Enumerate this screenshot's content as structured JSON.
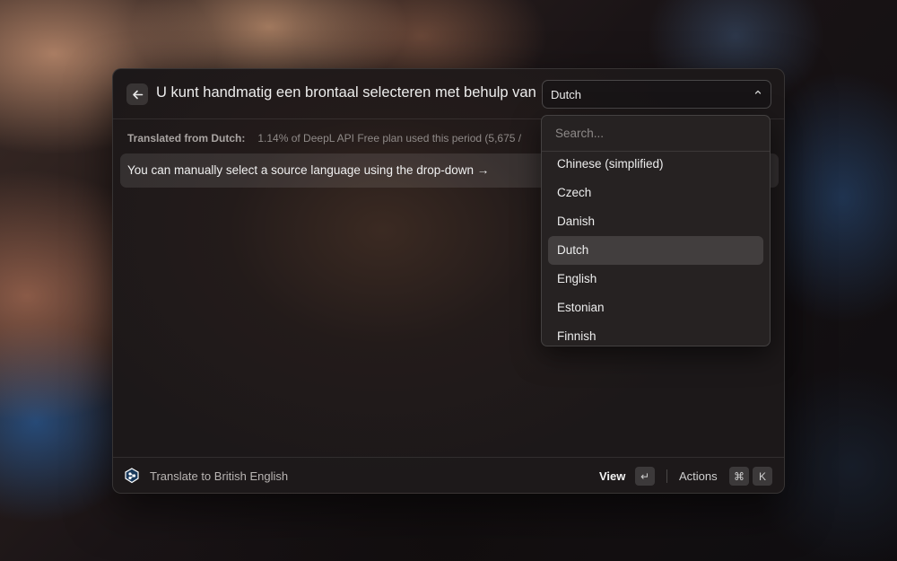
{
  "header": {
    "query": "U kunt handmatig een brontaal selecteren met behulp van de vervolgkeuzelijst",
    "language_select_value": "Dutch"
  },
  "meta": {
    "label": "Translated from Dutch:",
    "usage": "1.14% of DeepL API Free plan used this period (5,675 /"
  },
  "result": {
    "text": "You can manually select a source language using the drop-down →"
  },
  "dropdown_list": {
    "search_placeholder": "Search...",
    "options": [
      "Chinese (simplified)",
      "Czech",
      "Danish",
      "Dutch",
      "English",
      "Estonian",
      "Finnish"
    ],
    "selected": "Dutch"
  },
  "footer": {
    "command_title": "Translate to British English",
    "primary_action": "View",
    "primary_key": "↵",
    "actions_label": "Actions",
    "actions_key_1": "⌘",
    "actions_key_2": "K"
  },
  "colors": {
    "deepl_icon_bg": "#1a3a5c"
  },
  "icons": {
    "back": "arrow-left-icon",
    "chevron": "chevron-up-down-icon",
    "deepl": "deepl-logo-icon"
  }
}
